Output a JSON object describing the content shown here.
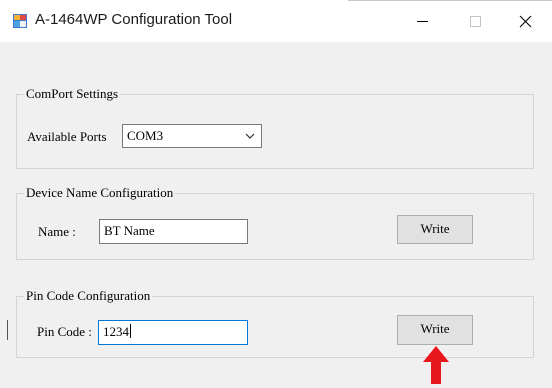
{
  "window": {
    "title": "A-1464WP Configuration Tool",
    "icon": "app-window-icon"
  },
  "comport": {
    "group_title": "ComPort Settings",
    "ports_label": "Available Ports",
    "selected_port": "COM3"
  },
  "device": {
    "group_title": "Device Name Configuration",
    "name_label": "Name :",
    "name_value": "BT Name",
    "write_label": "Write"
  },
  "pin": {
    "group_title": "Pin Code Configuration",
    "pin_label": "Pin Code :",
    "pin_value": "1234",
    "write_label": "Write"
  },
  "colors": {
    "client_bg": "#f0f0f0",
    "titlebar_bg": "#ffffff",
    "focus_border": "#0078d7",
    "button_bg": "#e1e1e1",
    "annotation_arrow": "#e8171d"
  }
}
